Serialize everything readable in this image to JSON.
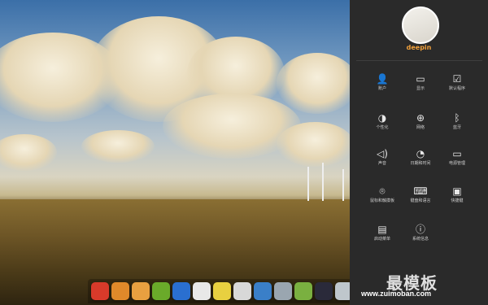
{
  "user": {
    "name": "deepin"
  },
  "settings": [
    {
      "label": "账户",
      "icon": "user-icon"
    },
    {
      "label": "显示",
      "icon": "display-icon"
    },
    {
      "label": "默认程序",
      "icon": "default-apps-icon"
    },
    {
      "label": "个性化",
      "icon": "personalization-icon"
    },
    {
      "label": "网络",
      "icon": "network-icon"
    },
    {
      "label": "蓝牙",
      "icon": "bluetooth-icon"
    },
    {
      "label": "声音",
      "icon": "sound-icon"
    },
    {
      "label": "日期和时间",
      "icon": "clock-icon"
    },
    {
      "label": "电源管理",
      "icon": "battery-icon"
    },
    {
      "label": "鼠标和触摸板",
      "icon": "mouse-icon"
    },
    {
      "label": "键盘和语言",
      "icon": "keyboard-icon"
    },
    {
      "label": "快捷键",
      "icon": "shortcut-icon"
    },
    {
      "label": "启动菜单",
      "icon": "boot-menu-icon"
    },
    {
      "label": "系统信息",
      "icon": "info-icon"
    }
  ],
  "dock": [
    {
      "icon": "launcher-icon",
      "color": "#d83a2a"
    },
    {
      "icon": "store-icon",
      "color": "#e0892a"
    },
    {
      "icon": "music-icon",
      "color": "#e8a040"
    },
    {
      "icon": "player-icon",
      "color": "#6aaa2a"
    },
    {
      "icon": "globe-icon",
      "color": "#2a6fd0"
    },
    {
      "icon": "chrome-icon",
      "color": "#e8e8e8"
    },
    {
      "icon": "photos-icon",
      "color": "#e8d040"
    },
    {
      "icon": "settings-icon",
      "color": "#d8d8d8"
    },
    {
      "icon": "users-icon",
      "color": "#3a7fc8"
    },
    {
      "icon": "terminal-icon",
      "color": "#9aa6b0"
    },
    {
      "icon": "green-app-icon",
      "color": "#7ab040"
    },
    {
      "icon": "dark-app-icon",
      "color": "#2a2a3a"
    },
    {
      "icon": "trash-icon",
      "color": "#bfc7cc"
    }
  ],
  "watermark": {
    "logo": "最模板",
    "url": "www.zuimoban.com"
  }
}
